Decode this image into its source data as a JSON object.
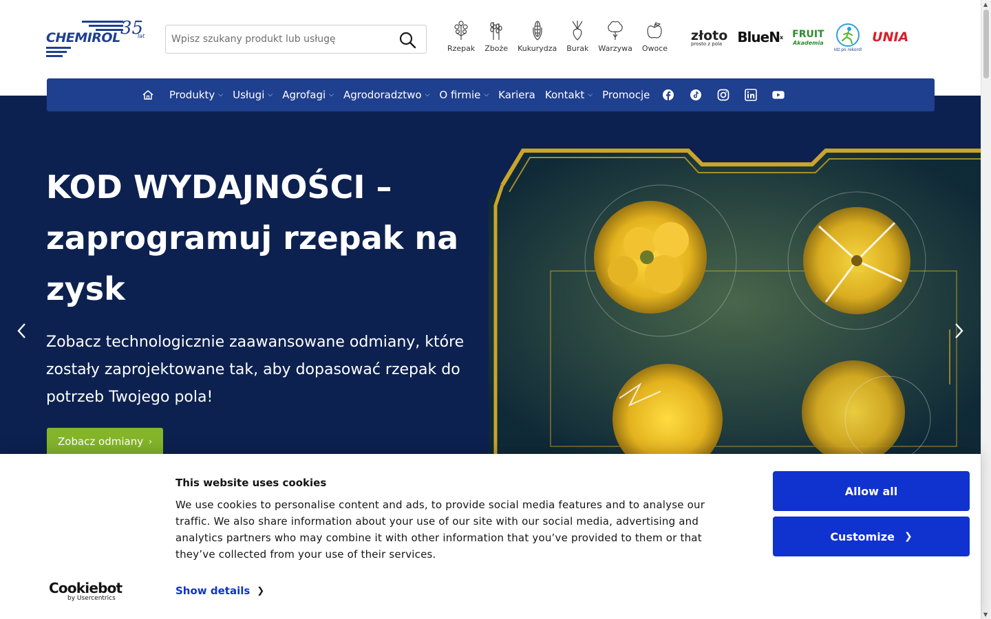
{
  "header": {
    "logo": {
      "brand": "CHEMIROL",
      "anniversary": "35",
      "anniversary_suffix": "lat"
    },
    "search": {
      "placeholder": "Wpisz szukany produkt lub usługę",
      "value": ""
    },
    "crops": [
      {
        "label": "Rzepak",
        "icon": "rapeseed-icon"
      },
      {
        "label": "Zboże",
        "icon": "grain-icon"
      },
      {
        "label": "Kukurydza",
        "icon": "corn-icon"
      },
      {
        "label": "Burak",
        "icon": "beet-icon"
      },
      {
        "label": "Warzywa",
        "icon": "vegetables-icon"
      },
      {
        "label": "Owoce",
        "icon": "fruit-icon"
      }
    ],
    "brands": {
      "zloto": {
        "name": "złoto",
        "tagline": "prosto z pola"
      },
      "bluen": {
        "name": "BlueN",
        "mark": "x"
      },
      "fruit": {
        "name": "FRUIT",
        "sub": "Akademia"
      },
      "idz": {
        "tagline": "Idź po rekord!"
      },
      "unia": {
        "name": "UNIA"
      }
    }
  },
  "nav": {
    "items": [
      {
        "label": "Produkty",
        "dropdown": true
      },
      {
        "label": "Usługi",
        "dropdown": true
      },
      {
        "label": "Agrofagi",
        "dropdown": true
      },
      {
        "label": "Agrodoradztwo",
        "dropdown": true
      },
      {
        "label": "O firmie",
        "dropdown": true
      },
      {
        "label": "Kariera",
        "dropdown": false
      },
      {
        "label": "Kontakt",
        "dropdown": true
      },
      {
        "label": "Promocje",
        "dropdown": false
      }
    ],
    "social": [
      "facebook-icon",
      "tiktok-icon",
      "instagram-icon",
      "linkedin-icon",
      "youtube-icon"
    ]
  },
  "hero": {
    "title": "KOD WYDAJNOŚCI – zaprogramuj rzepak na zysk",
    "subtitle": "Zobacz technologicznie zaawansowane odmiany, które zostały zaprojektowane tak, aby dopasować rzepak do potrzeb Twojego pola!",
    "cta": "Zobacz odmiany"
  },
  "cookie": {
    "title": "This website uses cookies",
    "text": "We use cookies to personalise content and ads, to provide social media features and to analyse our traffic. We also share information about your use of our site with our social media, advertising and analytics partners who may combine it with other information that you’ve provided to them or that they’ve collected from your use of their services.",
    "show_details": "Show details",
    "allow_all": "Allow all",
    "customize": "Customize",
    "provider": "Cookiebot",
    "provider_sub": "by Usercentrics"
  },
  "colors": {
    "brand_blue": "#1f3f8f",
    "hero_bg": "#0d2150",
    "cta_green": "#84b529",
    "cookie_button": "#1032cf",
    "accent_yellow": "#e0b623"
  }
}
